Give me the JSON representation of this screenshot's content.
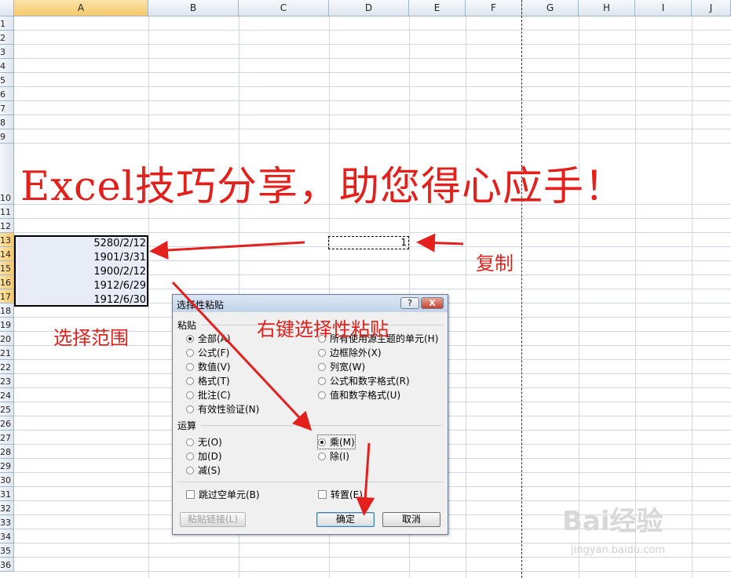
{
  "columns": [
    "A",
    "B",
    "C",
    "D",
    "E",
    "F",
    "G",
    "H",
    "I",
    "J"
  ],
  "rows": [
    "1",
    "2",
    "3",
    "4",
    "5",
    "6",
    "7",
    "8",
    "9",
    "10",
    "11",
    "12",
    "13",
    "14",
    "15",
    "16",
    "17",
    "18",
    "19",
    "20",
    "21",
    "22",
    "23",
    "24",
    "25",
    "26",
    "27",
    "28",
    "29",
    "30",
    "31",
    "32",
    "33",
    "34",
    "35",
    "36"
  ],
  "cells": {
    "a13": "5280/2/12",
    "a14": "1901/3/31",
    "a15": "1900/2/12",
    "a16": "1912/6/29",
    "a17": "1912/6/30",
    "d13": "1"
  },
  "annotations": {
    "title": "Excel技巧分享，助您得心应手！",
    "copy": "复制",
    "select_range": "选择范围",
    "right_click": "右键选择性粘贴"
  },
  "dialog": {
    "title": "选择性粘贴",
    "help": "?",
    "close": "X",
    "paste_section": "粘贴",
    "paste_left": [
      "全部(A)",
      "公式(F)",
      "数值(V)",
      "格式(T)",
      "批注(C)",
      "有效性验证(N)"
    ],
    "paste_right": [
      "所有使用源主题的单元(H)",
      "边框除外(X)",
      "列宽(W)",
      "公式和数字格式(R)",
      "值和数字格式(U)"
    ],
    "operation_section": "运算",
    "op_left": [
      "无(O)",
      "加(D)",
      "减(S)"
    ],
    "op_right": [
      "乘(M)",
      "除(I)"
    ],
    "skip_blanks": "跳过空单元(B)",
    "transpose": "转置(E)",
    "paste_link": "粘贴链接(L)",
    "ok": "确定",
    "cancel": "取消"
  },
  "watermark": {
    "brand": "Bai经验",
    "url": "jingyan.baidu.com"
  },
  "colors": {
    "annotation_red": "#e3201b",
    "header_selected": "#f5c96b"
  }
}
